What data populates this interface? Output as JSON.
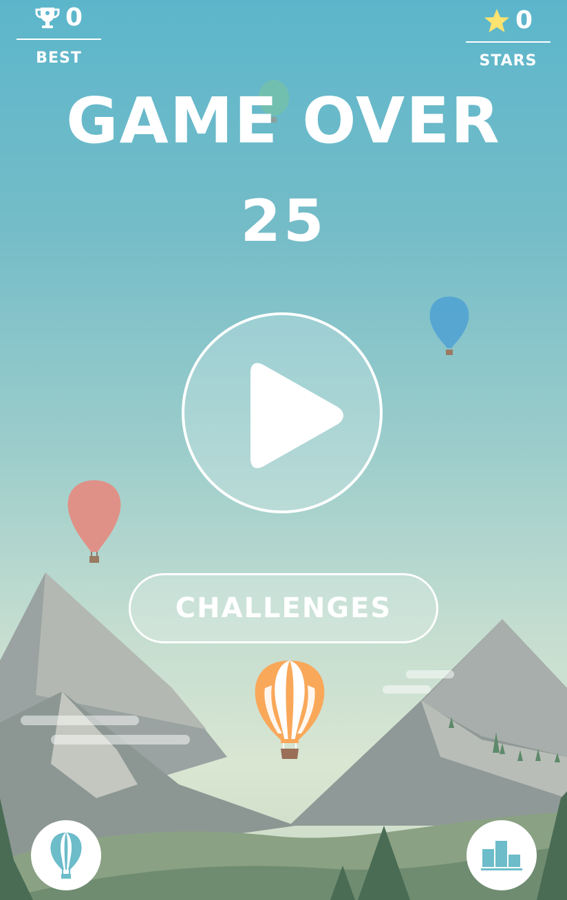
{
  "best": {
    "value": "0",
    "label": "BEST",
    "icon": "trophy-icon"
  },
  "stars": {
    "value": "0",
    "label": "STARS",
    "icon": "star-icon"
  },
  "title": "GAME OVER",
  "score": "25",
  "buttons": {
    "play": {
      "icon": "play-icon"
    },
    "challenges": {
      "label": "CHALLENGES"
    },
    "balloons": {
      "icon": "balloon-icon"
    },
    "leaderboard": {
      "icon": "leaderboard-icon"
    }
  },
  "colors": {
    "star": "#fde370",
    "button_icon": "#6cbcca",
    "player_balloon": "#f9a85a"
  }
}
